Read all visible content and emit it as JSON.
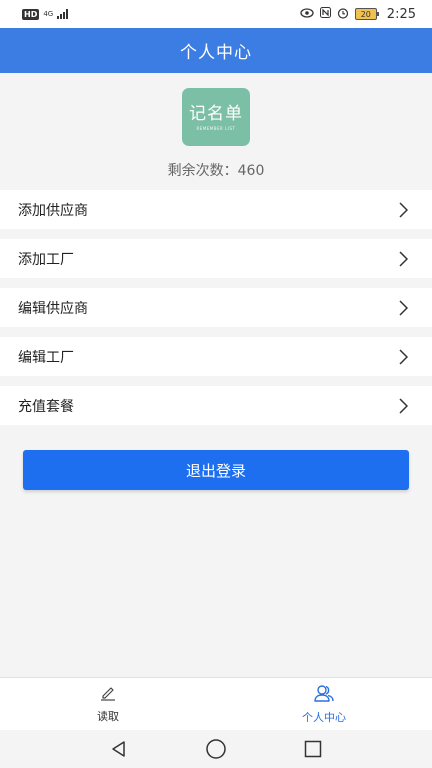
{
  "status_bar": {
    "hd": "HD",
    "network": "4G",
    "battery": "20",
    "time": "2:25"
  },
  "header": {
    "title": "个人中心"
  },
  "logo": {
    "main": "记名单",
    "sub": "REMEMBER LIST"
  },
  "remaining": {
    "text": "剩余次数：460"
  },
  "menu": {
    "items": [
      {
        "label": "添加供应商"
      },
      {
        "label": "添加工厂"
      },
      {
        "label": "编辑供应商"
      },
      {
        "label": "编辑工厂"
      },
      {
        "label": "充值套餐"
      }
    ]
  },
  "logout": {
    "label": "退出登录"
  },
  "tabs": [
    {
      "label": "读取",
      "icon": "pencil-icon"
    },
    {
      "label": "个人中心",
      "icon": "user-icon",
      "active": true
    }
  ],
  "colors": {
    "primary": "#3b7de3",
    "button": "#1e6ff0",
    "logo_bg": "#7bbfa6",
    "active_tab": "#2b6fe0"
  }
}
